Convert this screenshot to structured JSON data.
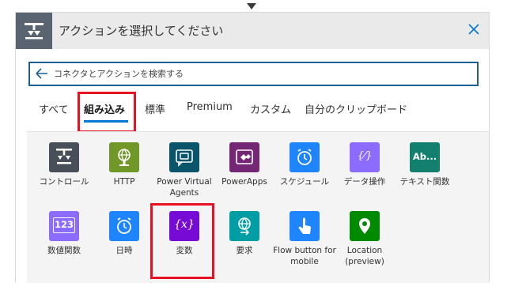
{
  "window": {
    "title": "アクションを選択してください",
    "accent": "#0078d4",
    "highlight": "#e81123"
  },
  "search": {
    "placeholder": "コネクタとアクションを検索する",
    "value": ""
  },
  "tabs": [
    {
      "label": "すべて",
      "active": false
    },
    {
      "label": "組み込み",
      "active": true
    },
    {
      "label": "標準",
      "active": false
    },
    {
      "label": "Premium",
      "active": false
    },
    {
      "label": "カスタム",
      "active": false
    },
    {
      "label": "自分のクリップボード",
      "active": false
    }
  ],
  "actions": [
    {
      "label": "コントロール",
      "icon": "control-icon",
      "color": "#484f58"
    },
    {
      "label": "HTTP",
      "icon": "http-globe-icon",
      "color": "#709727"
    },
    {
      "label": "Power Virtual Agents",
      "icon": "power-virtual-agents-icon",
      "color": "#0b556a"
    },
    {
      "label": "PowerApps",
      "icon": "powerapps-icon",
      "color": "#742774"
    },
    {
      "label": "スケジュール",
      "icon": "schedule-icon",
      "color": "#1f85ff"
    },
    {
      "label": "データ操作",
      "icon": "data-operation-icon",
      "color": "#8c6cff"
    },
    {
      "label": "テキスト関数",
      "icon": "text-functions-icon",
      "color": "#13806d"
    },
    {
      "label": "数値関数",
      "icon": "number-functions-icon",
      "color": "#8c6cff"
    },
    {
      "label": "日時",
      "icon": "datetime-icon",
      "color": "#1f85ff"
    },
    {
      "label": "変数",
      "icon": "variable-icon",
      "color": "#770bd6"
    },
    {
      "label": "要求",
      "icon": "request-icon",
      "color": "#009da5"
    },
    {
      "label": "Flow button for mobile",
      "icon": "flow-button-icon",
      "color": "#1f85ff"
    },
    {
      "label": "Location (preview)",
      "icon": "location-icon",
      "color": "#008a00"
    }
  ],
  "text_functions_badge": "Ab...",
  "number_functions_badge": "123",
  "variable_badge": "{x}",
  "data_operation_badge": "{⁄}"
}
